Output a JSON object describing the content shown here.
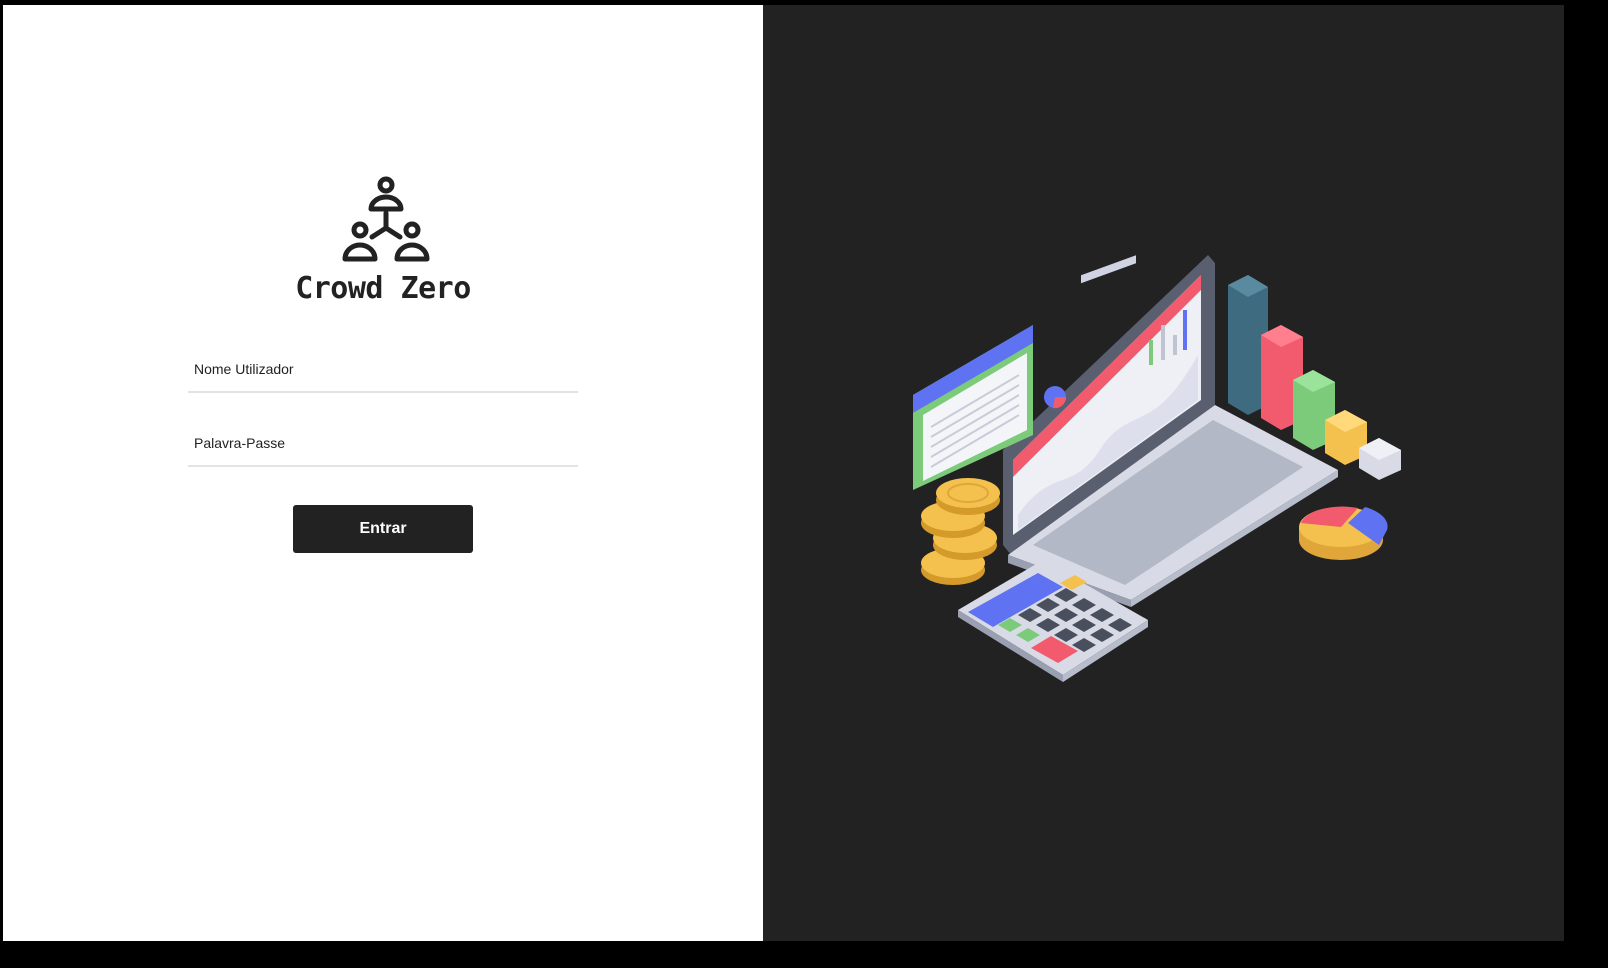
{
  "brand": {
    "name": "Crowd Zero",
    "logo_icon": "people-network-icon"
  },
  "login_form": {
    "username_placeholder": "Nome Utilizador",
    "password_placeholder": "Palavra-Passe",
    "submit_label": "Entrar"
  },
  "illustration": {
    "icon": "laptop-analytics-illustration",
    "colors": {
      "background": "#222222",
      "accent_red": "#f25a6e",
      "accent_blue": "#5f72f2",
      "accent_green": "#7ccb7a",
      "accent_yellow": "#f5c14e",
      "accent_teal": "#3f6b80"
    }
  }
}
